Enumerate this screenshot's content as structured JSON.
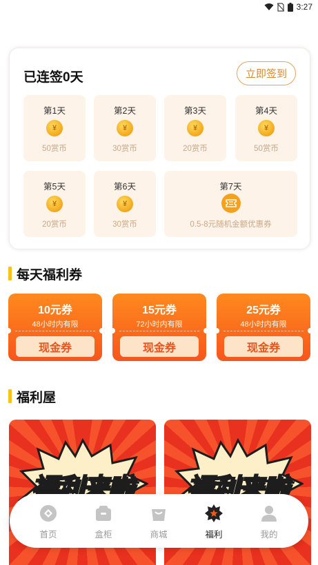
{
  "status_bar": {
    "time": "3:27"
  },
  "signin": {
    "title": "已连签0天",
    "button_label": "立即签到",
    "days": [
      {
        "label": "第1天",
        "reward": "50赏币",
        "icon": "coin-icon"
      },
      {
        "label": "第2天",
        "reward": "30赏币",
        "icon": "coin-icon"
      },
      {
        "label": "第3天",
        "reward": "20赏币",
        "icon": "coin-icon"
      },
      {
        "label": "第4天",
        "reward": "50赏币",
        "icon": "coin-icon"
      },
      {
        "label": "第5天",
        "reward": "20赏币",
        "icon": "coin-icon"
      },
      {
        "label": "第6天",
        "reward": "30赏币",
        "icon": "coin-icon"
      },
      {
        "label": "第7天",
        "reward": "0.5-8元随机金额优惠券",
        "icon": "ticket-icon"
      }
    ]
  },
  "daily_coupons": {
    "title": "每天福利券",
    "items": [
      {
        "amount": "10元券",
        "validity": "48小时内有限",
        "button": "现金券"
      },
      {
        "amount": "15元券",
        "validity": "72小时内有限",
        "button": "现金券"
      },
      {
        "amount": "25元券",
        "validity": "48小时内有限",
        "button": "现金券"
      }
    ]
  },
  "welfare_house": {
    "title": "福利屋",
    "cards": [
      {
        "banner_text": "福利来啦"
      },
      {
        "banner_text": "福利来啦"
      }
    ]
  },
  "tab_bar": {
    "active": "福利",
    "items": [
      {
        "label": "首页",
        "icon": "home-icon"
      },
      {
        "label": "盒柜",
        "icon": "box-icon"
      },
      {
        "label": "商城",
        "icon": "shop-bag-icon"
      },
      {
        "label": "福利",
        "icon": "welfare-star-icon"
      },
      {
        "label": "我的",
        "icon": "profile-icon"
      }
    ]
  },
  "colors": {
    "accent_orange": "#f6561c",
    "accent_yellow": "#f7c21a",
    "signin_border": "#e2a35a",
    "day_bg": "#fdf3e8"
  }
}
